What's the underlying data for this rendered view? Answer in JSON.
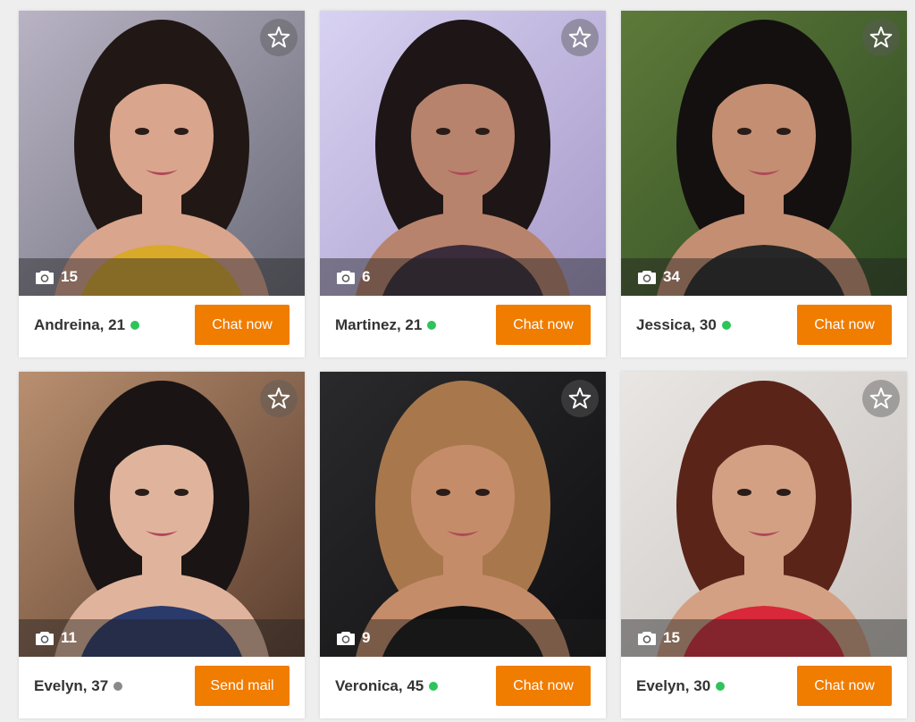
{
  "theme": {
    "accent": "#f07c00",
    "online": "#2fc35b",
    "offline": "#8a8a8a"
  },
  "icons": {
    "photo_count": "camera-icon",
    "favorite": "star-outline-icon",
    "status": "status-dot"
  },
  "profiles": [
    {
      "name": "Andreina, 21",
      "photos": "15",
      "status": "online",
      "action": "Chat now",
      "palette": {
        "bg1": "#b9b3c4",
        "bg2": "#6a6b78",
        "skin": "#d9a58c",
        "hair": "#211815",
        "cloth": "#d9a92a"
      }
    },
    {
      "name": "Martinez, 21",
      "photos": "6",
      "status": "online",
      "action": "Chat now",
      "palette": {
        "bg1": "#d8d2f2",
        "bg2": "#a79ac9",
        "skin": "#b8836c",
        "hair": "#1e1616",
        "cloth": "#3a2c3a"
      }
    },
    {
      "name": "Jessica, 30",
      "photos": "34",
      "status": "online",
      "action": "Chat now",
      "palette": {
        "bg1": "#5e7a3a",
        "bg2": "#2e4a22",
        "skin": "#c48e72",
        "hair": "#141010",
        "cloth": "#272727"
      }
    },
    {
      "name": "Evelyn, 37",
      "photos": "11",
      "status": "offline",
      "action": "Send mail",
      "palette": {
        "bg1": "#b98f6f",
        "bg2": "#5a3d2e",
        "skin": "#e0b49c",
        "hair": "#1b1414",
        "cloth": "#2a3a6a"
      }
    },
    {
      "name": "Veronica, 45",
      "photos": "9",
      "status": "online",
      "action": "Chat now",
      "palette": {
        "bg1": "#2a2a2c",
        "bg2": "#101012",
        "skin": "#c58c6a",
        "hair": "#a8784c",
        "cloth": "#111111"
      }
    },
    {
      "name": "Evelyn, 30",
      "photos": "15",
      "status": "online",
      "action": "Chat now",
      "palette": {
        "bg1": "#e9e6e3",
        "bg2": "#c9c4c0",
        "skin": "#d4a084",
        "hair": "#5a2418",
        "cloth": "#d8283a"
      }
    }
  ]
}
